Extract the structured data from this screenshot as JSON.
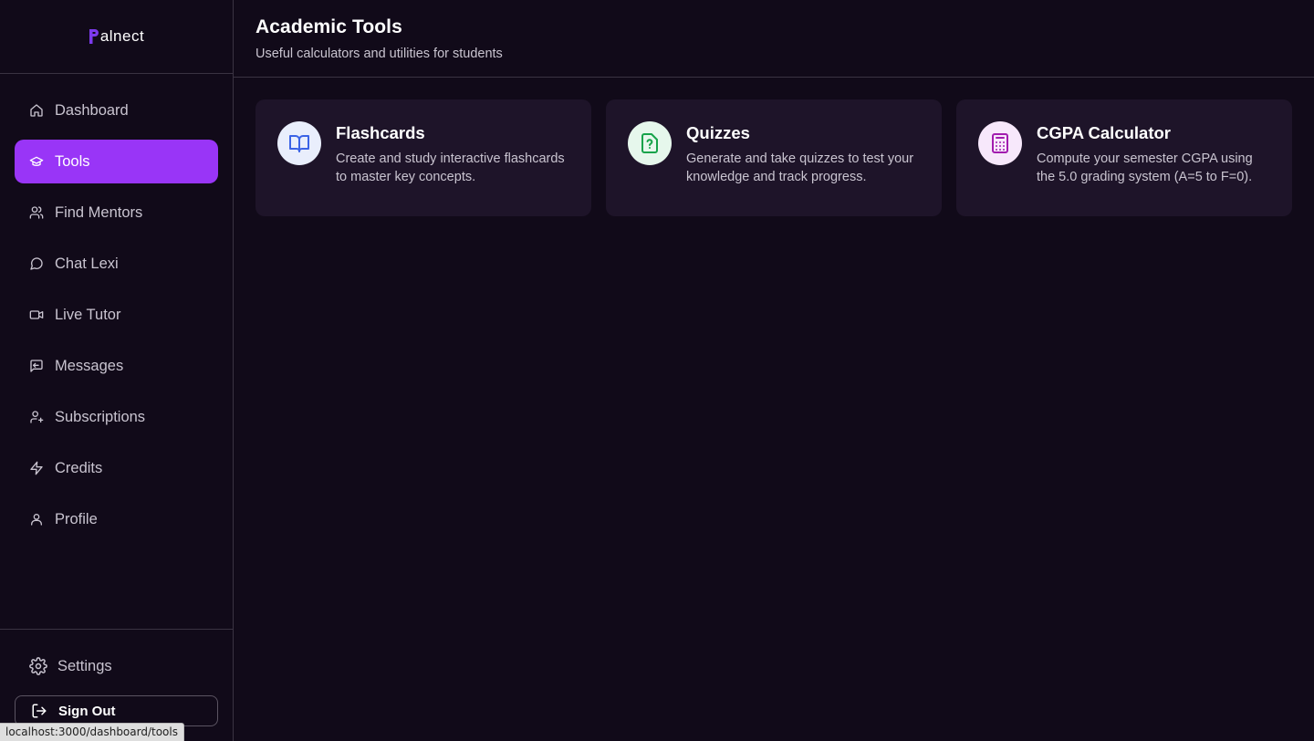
{
  "brand": {
    "name": "alnect",
    "logo_letter": "P",
    "accent": "#9935f7",
    "logo_color": "#7c3aed"
  },
  "sidebar": {
    "items": [
      {
        "label": "Dashboard",
        "icon": "home-icon",
        "active": false
      },
      {
        "label": "Tools",
        "icon": "graduation-cap-icon",
        "active": true
      },
      {
        "label": "Find Mentors",
        "icon": "users-icon",
        "active": false
      },
      {
        "label": "Chat Lexi",
        "icon": "chat-bubble-icon",
        "active": false
      },
      {
        "label": "Live Tutor",
        "icon": "video-camera-icon",
        "active": false
      },
      {
        "label": "Messages",
        "icon": "message-square-icon",
        "active": false
      },
      {
        "label": "Subscriptions",
        "icon": "user-plus-icon",
        "active": false
      },
      {
        "label": "Credits",
        "icon": "lightning-icon",
        "active": false
      },
      {
        "label": "Profile",
        "icon": "user-icon",
        "active": false
      }
    ],
    "settings_label": "Settings",
    "signout_label": "Sign Out"
  },
  "header": {
    "title": "Academic Tools",
    "subtitle": "Useful calculators and utilities for students"
  },
  "tools": [
    {
      "title": "Flashcards",
      "description": "Create and study interactive flashcards to master key concepts.",
      "icon": "book-open-icon",
      "icon_color": "#3b63e6",
      "icon_bg": "#e9eefc"
    },
    {
      "title": "Quizzes",
      "description": "Generate and take quizzes to test your knowledge and track progress.",
      "icon": "file-question-icon",
      "icon_color": "#16a34a",
      "icon_bg": "#e6f7ec"
    },
    {
      "title": "CGPA Calculator",
      "description": "Compute your semester CGPA using the 5.0 grading system (A=5 to F=0).",
      "icon": "calculator-icon",
      "icon_color": "#a21caf",
      "icon_bg": "#f7e8fb"
    }
  ],
  "status_bar": {
    "url": "localhost:3000/dashboard/tools"
  }
}
